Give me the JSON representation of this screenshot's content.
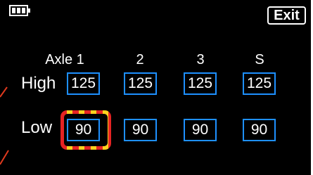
{
  "header": {
    "exit_label": "Exit"
  },
  "columns": [
    "Axle 1",
    "2",
    "3",
    "S"
  ],
  "rows": [
    {
      "label": "High",
      "values": [
        "125",
        "125",
        "125",
        "125"
      ]
    },
    {
      "label": "Low",
      "values": [
        "90",
        "90",
        "90",
        "90"
      ]
    }
  ],
  "selected": {
    "row": "Low",
    "column": "Axle 1"
  },
  "colors": {
    "background": "#000000",
    "text": "#ffffff",
    "cell_border": "#1e90ff",
    "selection_red": "#e62323",
    "selection_yellow": "#ffd21e",
    "pointer_line": "#e03a1e"
  },
  "icons": [
    "battery-icon"
  ]
}
